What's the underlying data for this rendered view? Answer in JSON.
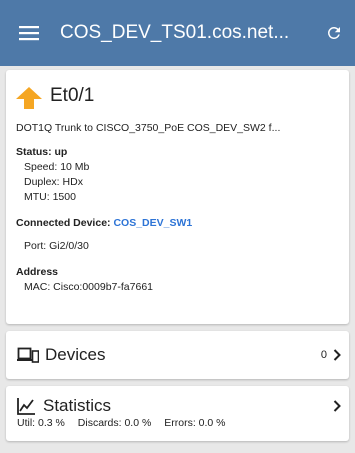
{
  "appbar": {
    "title": "COS_DEV_TS01.cos.net...",
    "background": "#4e79a8",
    "menu_icon": "hamburger-menu-icon",
    "refresh_icon": "refresh-icon"
  },
  "port": {
    "name": "Et0/1",
    "status_icon": "up-arrow-icon",
    "status_icon_color": "#f5a623",
    "description": "DOT1Q Trunk to CISCO_3750_PoE COS_DEV_SW2 f...",
    "status_label": "Status:",
    "status_value": "up",
    "speed_label": "Speed:",
    "speed_value": "10 Mb",
    "duplex_label": "Duplex:",
    "duplex_value": "HDx",
    "mtu_label": "MTU:",
    "mtu_value": "1500",
    "connected_label": "Connected Device:",
    "connected_device": "COS_DEV_SW1",
    "port_label": "Port:",
    "port_value": "Gi2/0/30",
    "address_label": "Address",
    "mac_label": "MAC:",
    "mac_value": "Cisco:0009b7-fa7661"
  },
  "devices": {
    "title": "Devices",
    "count": "0",
    "icon": "devices-icon"
  },
  "statistics": {
    "title": "Statistics",
    "icon": "statistics-chart-icon",
    "util": "Util: 0.3 %",
    "discards": "Discards: 0.0 %",
    "errors": "Errors: 0.0 %"
  },
  "colors": {
    "link": "#2d74d6",
    "page_background": "#e8e8e8"
  }
}
